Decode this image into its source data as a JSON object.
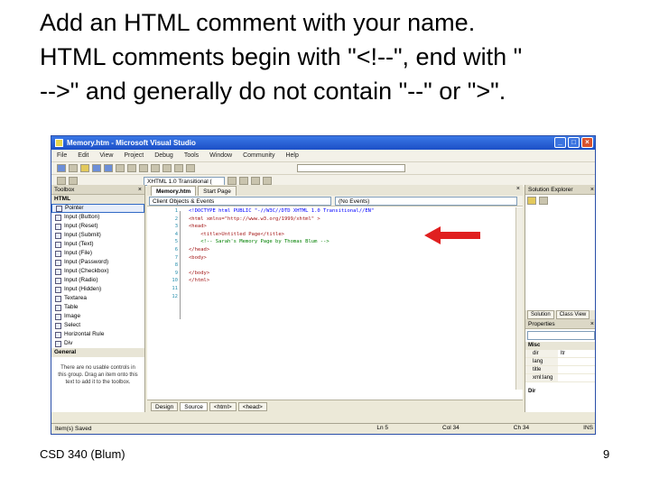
{
  "slide": {
    "title_lines": [
      "Add an HTML comment with your name.",
      "HTML comments begin with \"<!--\", end with \"",
      "-->\" and generally do not contain \"--\" or \">\"."
    ],
    "footer_left": "CSD 340 (Blum)",
    "page_number": "9"
  },
  "window": {
    "title": "Memory.htm - Microsoft Visual Studio",
    "buttons": {
      "minimize": "_",
      "maximize": "□",
      "close": "×"
    },
    "menu": [
      "File",
      "Edit",
      "View",
      "Project",
      "Debug",
      "Tools",
      "Window",
      "Community",
      "Help"
    ],
    "toolbar": {
      "doctype_combo": "XHTML 1.0 Transitional ("
    }
  },
  "toolbox": {
    "title": "Toolbox",
    "close": "×",
    "section_html": "HTML",
    "items": [
      "Pointer",
      "Input (Button)",
      "Input (Reset)",
      "Input (Submit)",
      "Input (Text)",
      "Input (File)",
      "Input (Password)",
      "Input (Checkbox)",
      "Input (Radio)",
      "Input (Hidden)",
      "Textarea",
      "Table",
      "Image",
      "Select",
      "Horizontal Rule",
      "Div"
    ],
    "section_general": "General",
    "hint": "There are no usable controls in this group. Drag an item onto this text to add it to the toolbox."
  },
  "editor": {
    "tabs": [
      "Memory.htm",
      "Start Page"
    ],
    "close": "×",
    "nav_left": "Client Objects & Events",
    "nav_right": "(No Events)",
    "line_numbers": [
      "1",
      "2",
      "3",
      "4",
      "5",
      "6",
      "7",
      "8",
      "9",
      "10",
      "11",
      "12"
    ],
    "code_lines": [
      "<!DOCTYPE html PUBLIC \"-//W3C//DTD XHTML 1.0 Transitional//EN\"",
      "<html xmlns=\"http://www.w3.org/1999/xhtml\" >",
      "<head>",
      "    <title>Untitled Page</title>",
      "    <!-- Sarah's Memory Page by Thomas Blum -->",
      "</head>",
      "<body>",
      "",
      "</body>",
      "</html>",
      "",
      ""
    ],
    "bottom_tabs": [
      "Design",
      "Source",
      "<html>",
      "<head>"
    ]
  },
  "solution": {
    "title": "Solution Explorer",
    "close": "×",
    "tabs": [
      "Solution",
      "Class View"
    ]
  },
  "properties": {
    "title": "Properties",
    "close": "×",
    "category": "Misc",
    "rows": [
      {
        "key": "dir",
        "value": "ltr"
      },
      {
        "key": "lang",
        "value": ""
      },
      {
        "key": "title",
        "value": ""
      },
      {
        "key": "xml:lang",
        "value": ""
      }
    ],
    "footer": "Dir"
  },
  "status": {
    "left": "Item(s) Saved",
    "cells": [
      "Ln 5",
      "Col 34",
      "Ch 34",
      "INS"
    ]
  },
  "colors": {
    "titlebar": "#1c4fc7",
    "chrome": "#ece9d8",
    "arrow": "#e02020",
    "code_tag": "#a31515",
    "code_keyword": "#0000ff",
    "code_comment": "#008000"
  }
}
